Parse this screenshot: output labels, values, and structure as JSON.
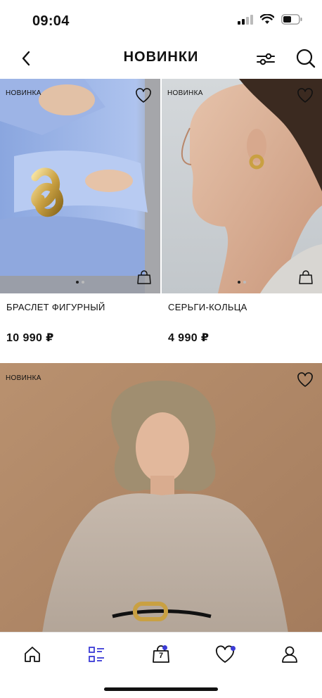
{
  "status_bar": {
    "time": "09:04",
    "icons": [
      "signal-icon",
      "wifi-icon",
      "battery-icon"
    ]
  },
  "nav": {
    "title": "НОВИНКИ",
    "icons": [
      "back-arrow-icon",
      "filter-sliders-icon",
      "search-icon"
    ]
  },
  "products": [
    {
      "badge": "НОВИНКА",
      "name": "БРАСЛЕТ ФИГУРНЫЙ",
      "price": "10 990 ₽",
      "image": "model-blue-shirt-gold-bracelet",
      "slides": 2,
      "active_slide": 0
    },
    {
      "badge": "НОВИНКА",
      "name": "СЕРЬГИ-КОЛЬЦА",
      "price": "4 990 ₽",
      "image": "model-profile-gold-hoop-earring",
      "slides": 2,
      "active_slide": 0
    },
    {
      "badge": "НОВИНКА",
      "image": "model-grey-sweater-chain-belt"
    }
  ],
  "tab_bar": {
    "items": [
      "home-icon",
      "catalog-icon",
      "cart-icon",
      "favorites-icon",
      "profile-icon"
    ],
    "active": "catalog-icon",
    "cart_count": "7",
    "accent": "#3b3bd6"
  },
  "colors": {
    "accent": "#3b3bd6",
    "text": "#111111"
  }
}
